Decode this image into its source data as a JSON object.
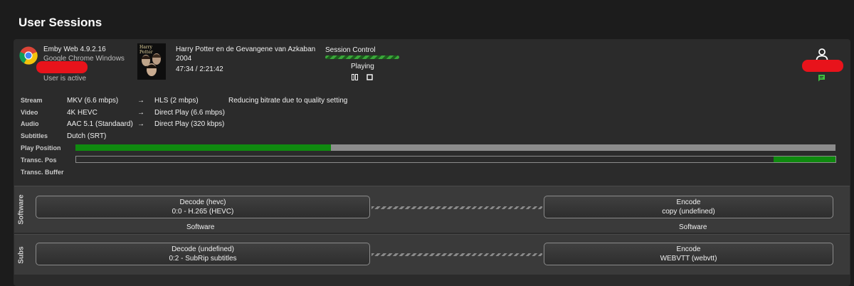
{
  "page_title": "User Sessions",
  "client": {
    "name": "Emby Web 4.9.2.16",
    "os": "Google Chrome Windows",
    "status": "User is active"
  },
  "media": {
    "title": "Harry Potter en de Gevangene van Azkaban",
    "year": "2004",
    "time": "47:34 / 2:21:42",
    "poster_text": "Harry Potter"
  },
  "session": {
    "label": "Session Control",
    "state": "Playing"
  },
  "info": {
    "stream": {
      "label": "Stream",
      "source": "MKV (6.6 mbps)",
      "arrow": "→",
      "target": "HLS (2 mbps)",
      "note": "Reducing bitrate due to quality setting"
    },
    "video": {
      "label": "Video",
      "source": "4K HEVC",
      "arrow": "→",
      "target": "Direct Play (6.6 mbps)"
    },
    "audio": {
      "label": "Audio",
      "source": "AAC 5.1 (Standaard)",
      "arrow": "→",
      "target": "Direct Play (320 kbps)"
    },
    "subtitles": {
      "label": "Subtitles",
      "source": "Dutch (SRT)"
    },
    "play_position": {
      "label": "Play Position",
      "fraction": 0.336
    },
    "transc_pos": {
      "label": "Transc. Pos",
      "start_fraction": 0.918,
      "end_fraction": 1.0
    },
    "transc_buffer": {
      "label": "Transc. Buffer"
    }
  },
  "pipeline": {
    "software": {
      "label": "Software",
      "decode": {
        "title": "Decode (hevc)",
        "detail": "0:0 - H.265 (HEVC)",
        "caption": "Software"
      },
      "encode": {
        "title": "Encode",
        "detail": "copy (undefined)",
        "caption": "Software"
      }
    },
    "subs": {
      "label": "Subs",
      "decode": {
        "title": "Decode (undefined)",
        "detail": "0:2 - SubRip subtitles"
      },
      "encode": {
        "title": "Encode",
        "detail": "WEBVTT (webvtt)"
      }
    }
  },
  "colors": {
    "accent_green": "#0f8a0f",
    "redaction": "#e8131b",
    "chat_icon": "#3fbf3f"
  }
}
